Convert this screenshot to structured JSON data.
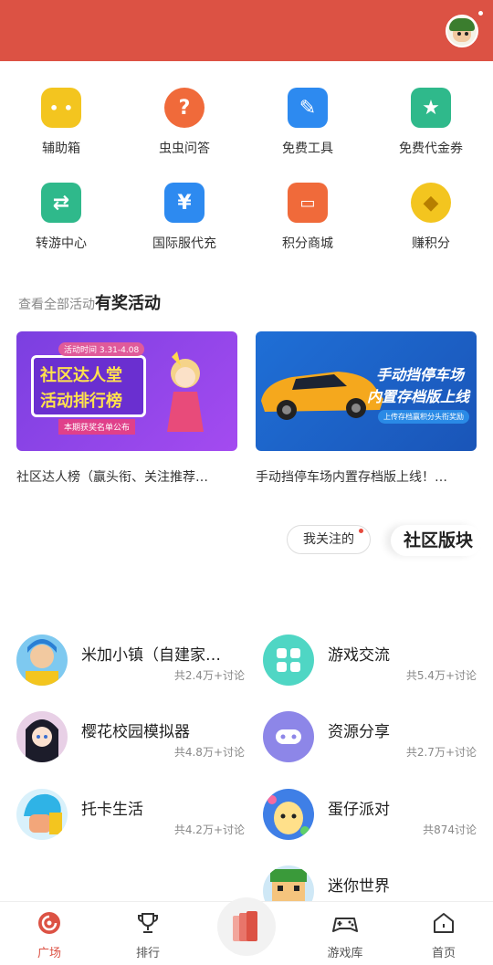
{
  "tools": [
    {
      "label": "辅助箱",
      "icon": "robot-face-icon",
      "color": "#f3c51f"
    },
    {
      "label": "虫虫问答",
      "icon": "question-bubble-icon",
      "color": "#f06a3a"
    },
    {
      "label": "免费工具",
      "icon": "wrench-toolbox-icon",
      "color": "#2d8af0"
    },
    {
      "label": "免费代金券",
      "icon": "coupon-star-icon",
      "color": "#2fb98b"
    },
    {
      "label": "转游中心",
      "icon": "swap-arrows-icon",
      "color": "#2fb98b"
    },
    {
      "label": "国际服代充",
      "icon": "yen-wallet-icon",
      "color": "#2d8af0"
    },
    {
      "label": "积分商城",
      "icon": "shop-icon",
      "color": "#f06a3a"
    },
    {
      "label": "赚积分",
      "icon": "coin-icon",
      "color": "#f3c51f"
    }
  ],
  "activities": {
    "view_all": "查看全部活动",
    "title": "有奖活动",
    "items": [
      {
        "caption": "社区达人榜（赢头衔、关注推荐…",
        "banner_lines": [
          "社区达人堂",
          "活动排行榜"
        ],
        "banner_top": "活动时间 3.31-4.08",
        "banner_bottom": "本期获奖名单公布"
      },
      {
        "caption": "手动挡停车场内置存档版上线！…",
        "banner_lines": [
          "手动挡停车场",
          "内置存档版上线"
        ],
        "banner_sub": "上传存档赢积分头衔奖励"
      }
    ]
  },
  "community": {
    "tab_following": "我关注的",
    "tab_active": "社区版块",
    "boards": [
      {
        "name": "米加小镇（自建家…",
        "stat": "共2.4万+讨论",
        "icon": "miga-town-avatar"
      },
      {
        "name": "游戏交流",
        "stat": "共5.4万+讨论",
        "icon": "grid-apps-icon"
      },
      {
        "name": "樱花校园模拟器",
        "stat": "共4.8万+讨论",
        "icon": "sakura-school-avatar"
      },
      {
        "name": "资源分享",
        "stat": "共2.7万+讨论",
        "icon": "gamepad-icon"
      },
      {
        "name": "托卡生活",
        "stat": "共4.2万+讨论",
        "icon": "toca-life-avatar"
      },
      {
        "name": "蛋仔派对",
        "stat": "共874讨论",
        "icon": "eggy-party-avatar"
      },
      {
        "name": "迷你世界",
        "stat": "",
        "icon": "mini-world-avatar"
      }
    ]
  },
  "nav": [
    {
      "label": "广场",
      "icon": "plaza-icon",
      "active": true
    },
    {
      "label": "排行",
      "icon": "trophy-icon"
    },
    {
      "label": "",
      "icon": "center-cards-icon"
    },
    {
      "label": "游戏库",
      "icon": "gamepad-outline-icon"
    },
    {
      "label": "首页",
      "icon": "home-icon"
    }
  ],
  "colors": {
    "header": "#dc5244",
    "accent": "#dc5244"
  }
}
